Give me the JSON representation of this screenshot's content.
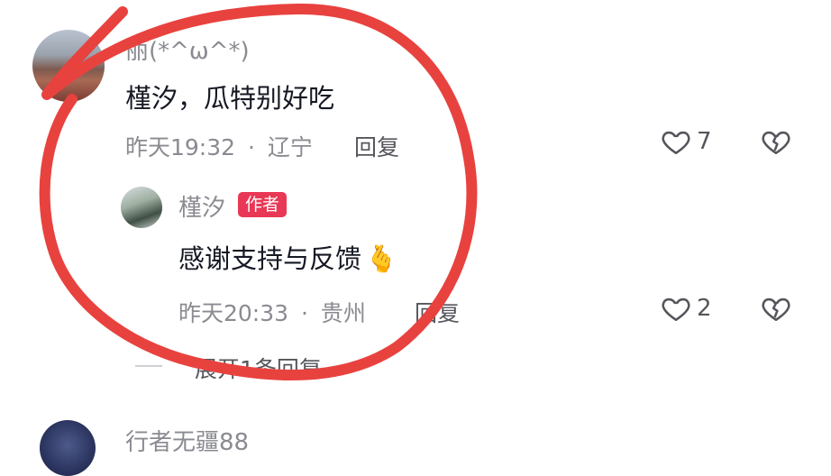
{
  "comment": {
    "username": "丽(*^ω^*)",
    "text": "槿汐，瓜特别好吃",
    "time": "昨天19:32",
    "separator": "·",
    "location": "辽宁",
    "reply_label": "回复",
    "like_count": "7"
  },
  "reply": {
    "username": "槿汐",
    "author_badge": "作者",
    "text": "感谢支持与反馈",
    "emoji": "🫰",
    "time": "昨天20:33",
    "separator": "·",
    "location": "贵州",
    "reply_label": "回复",
    "like_count": "2"
  },
  "expand_replies": "展开1条回复",
  "next_comment": {
    "username": "行者无疆88"
  },
  "colors": {
    "annotation_circle": "#e8423f",
    "badge": "#e83855"
  },
  "icons": [
    "heart-outline-icon",
    "broken-heart-icon",
    "finger-heart-emoji"
  ]
}
